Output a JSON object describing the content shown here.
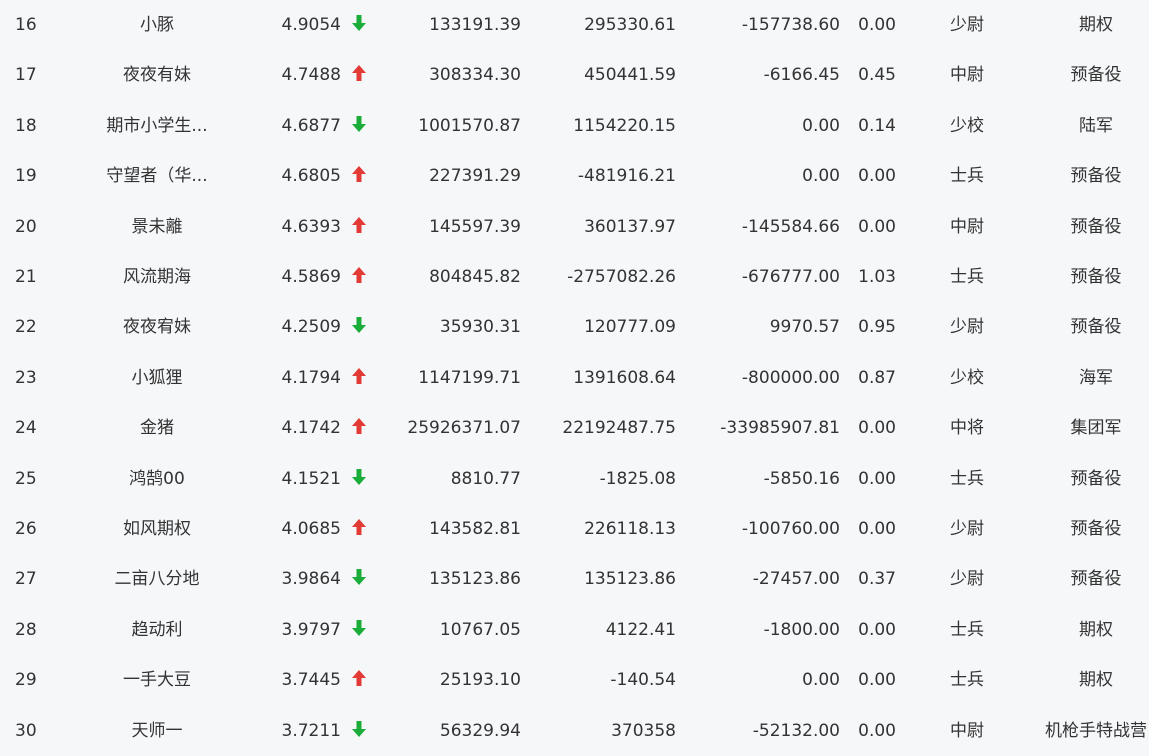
{
  "colors": {
    "up": "#e23a35",
    "down": "#1aad3a",
    "text": "#333333",
    "background": "#f6f7f9"
  },
  "rows": [
    {
      "rank": "16",
      "name": "小豚",
      "score": "4.9054",
      "trend": "down",
      "v1": "133191.39",
      "v2": "295330.61",
      "v3": "-157738.60",
      "v4": "0.00",
      "title": "少尉",
      "unit": "期权"
    },
    {
      "rank": "17",
      "name": "夜夜有妹",
      "score": "4.7488",
      "trend": "up",
      "v1": "308334.30",
      "v2": "450441.59",
      "v3": "-6166.45",
      "v4": "0.45",
      "title": "中尉",
      "unit": "预备役"
    },
    {
      "rank": "18",
      "name": "期市小学生...",
      "score": "4.6877",
      "trend": "down",
      "v1": "1001570.87",
      "v2": "1154220.15",
      "v3": "0.00",
      "v4": "0.14",
      "title": "少校",
      "unit": "陆军"
    },
    {
      "rank": "19",
      "name": "守望者（华...",
      "score": "4.6805",
      "trend": "up",
      "v1": "227391.29",
      "v2": "-481916.21",
      "v3": "0.00",
      "v4": "0.00",
      "title": "士兵",
      "unit": "预备役"
    },
    {
      "rank": "20",
      "name": "景未離",
      "score": "4.6393",
      "trend": "up",
      "v1": "145597.39",
      "v2": "360137.97",
      "v3": "-145584.66",
      "v4": "0.00",
      "title": "中尉",
      "unit": "预备役"
    },
    {
      "rank": "21",
      "name": "风流期海",
      "score": "4.5869",
      "trend": "up",
      "v1": "804845.82",
      "v2": "-2757082.26",
      "v3": "-676777.00",
      "v4": "1.03",
      "title": "士兵",
      "unit": "预备役"
    },
    {
      "rank": "22",
      "name": "夜夜宥妹",
      "score": "4.2509",
      "trend": "down",
      "v1": "35930.31",
      "v2": "120777.09",
      "v3": "9970.57",
      "v4": "0.95",
      "title": "少尉",
      "unit": "预备役"
    },
    {
      "rank": "23",
      "name": "小狐狸",
      "score": "4.1794",
      "trend": "up",
      "v1": "1147199.71",
      "v2": "1391608.64",
      "v3": "-800000.00",
      "v4": "0.87",
      "title": "少校",
      "unit": "海军"
    },
    {
      "rank": "24",
      "name": "金猪",
      "score": "4.1742",
      "trend": "up",
      "v1": "25926371.07",
      "v2": "22192487.75",
      "v3": "-33985907.81",
      "v4": "0.00",
      "title": "中将",
      "unit": "集团军"
    },
    {
      "rank": "25",
      "name": "鸿鹄00",
      "score": "4.1521",
      "trend": "down",
      "v1": "8810.77",
      "v2": "-1825.08",
      "v3": "-5850.16",
      "v4": "0.00",
      "title": "士兵",
      "unit": "预备役"
    },
    {
      "rank": "26",
      "name": "如风期权",
      "score": "4.0685",
      "trend": "up",
      "v1": "143582.81",
      "v2": "226118.13",
      "v3": "-100760.00",
      "v4": "0.00",
      "title": "少尉",
      "unit": "预备役"
    },
    {
      "rank": "27",
      "name": "二亩八分地",
      "score": "3.9864",
      "trend": "down",
      "v1": "135123.86",
      "v2": "135123.86",
      "v3": "-27457.00",
      "v4": "0.37",
      "title": "少尉",
      "unit": "预备役"
    },
    {
      "rank": "28",
      "name": "趋动利",
      "score": "3.9797",
      "trend": "down",
      "v1": "10767.05",
      "v2": "4122.41",
      "v3": "-1800.00",
      "v4": "0.00",
      "title": "士兵",
      "unit": "期权"
    },
    {
      "rank": "29",
      "name": "一手大豆",
      "score": "3.7445",
      "trend": "up",
      "v1": "25193.10",
      "v2": "-140.54",
      "v3": "0.00",
      "v4": "0.00",
      "title": "士兵",
      "unit": "期权"
    },
    {
      "rank": "30",
      "name": "天师一",
      "score": "3.7211",
      "trend": "down",
      "v1": "56329.94",
      "v2": "370358",
      "v3": "-52132.00",
      "v4": "0.00",
      "title": "中尉",
      "unit": "机枪手特战营"
    }
  ]
}
